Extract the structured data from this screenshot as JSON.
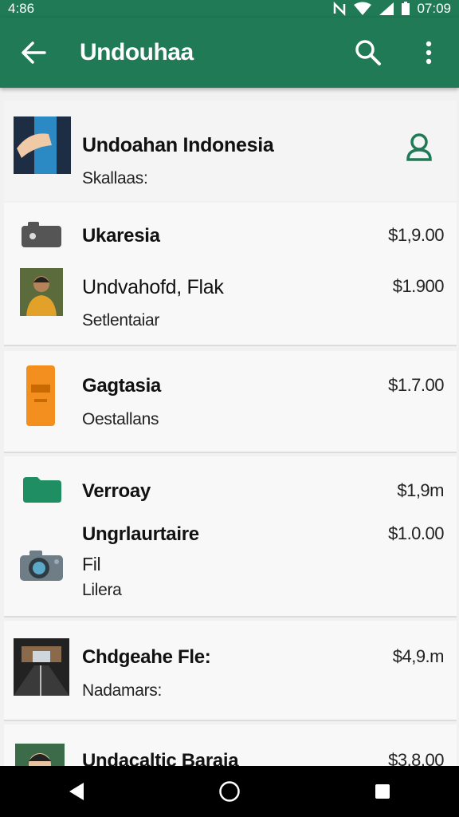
{
  "status": {
    "left_time": "4:86",
    "right_time": "07:09"
  },
  "appbar": {
    "title": "Undouhaa"
  },
  "header": {
    "title": "Undoahan Indonesia",
    "subtitle": "Skallaas:"
  },
  "items": [
    {
      "title": "Ukaresia",
      "price": "$1,9.00"
    },
    {
      "title": "Undvahofd, Flak",
      "subtitle": "Setlentaiar",
      "price": "$1.900"
    },
    {
      "title": "Gagtasia",
      "subtitle": "Oestallans",
      "price": "$1.7.00"
    },
    {
      "title": "Verroay",
      "price": "$1,9m"
    },
    {
      "title": "Ungrlaurtaire",
      "line1": "Fil",
      "line2": "Lilera",
      "price": "$1.0.00"
    },
    {
      "title": "Chdgeahe Fle:",
      "subtitle": "Nadamars:",
      "price": "$4,9.m"
    },
    {
      "title": "Undacaltic Baraia",
      "price": "$3.8.00"
    }
  ],
  "colors": {
    "primary": "#1f7a55",
    "accent": "#1f7a55"
  }
}
